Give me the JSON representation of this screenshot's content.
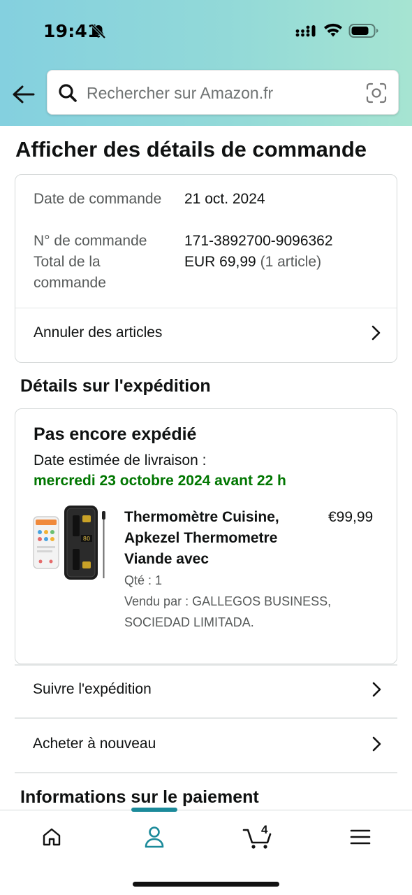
{
  "status_bar": {
    "time": "19:41"
  },
  "search": {
    "placeholder": "Rechercher sur Amazon.fr"
  },
  "page": {
    "title": "Afficher des détails de commande"
  },
  "order": {
    "date_label": "Date de commande",
    "date_value": "21 oct. 2024",
    "number_label": "N° de commande",
    "number_value": "171-3892700-9096362",
    "total_label": "Total de la commande",
    "total_value": "EUR 69,99",
    "total_count": "(1 article)",
    "cancel_label": "Annuler des articles"
  },
  "shipping": {
    "section_title": "Détails sur l'expédition",
    "status": "Pas encore expédié",
    "estimated_label": "Date estimée de livraison :",
    "estimated_date": "mercredi 23 octobre 2024 avant 22 h",
    "product": {
      "title": "Thermomètre Cuisine, Apkezel Thermometre Viande avec",
      "price": "€99,99",
      "quantity": "Qté : 1",
      "seller": "Vendu par : GALLEGOS BUSINESS, SOCIEDAD LIMITADA."
    },
    "track_label": "Suivre l'expédition",
    "buy_again_label": "Acheter à nouveau"
  },
  "payment": {
    "section_title": "Informations sur le paiement"
  },
  "tabbar": {
    "cart_count": "4",
    "active_tab": "profile"
  },
  "colors": {
    "header_gradient_start": "#84d0df",
    "header_gradient_end": "#a6e4d2",
    "delivery_green": "#007600",
    "active_tab": "#1b8a9a"
  }
}
